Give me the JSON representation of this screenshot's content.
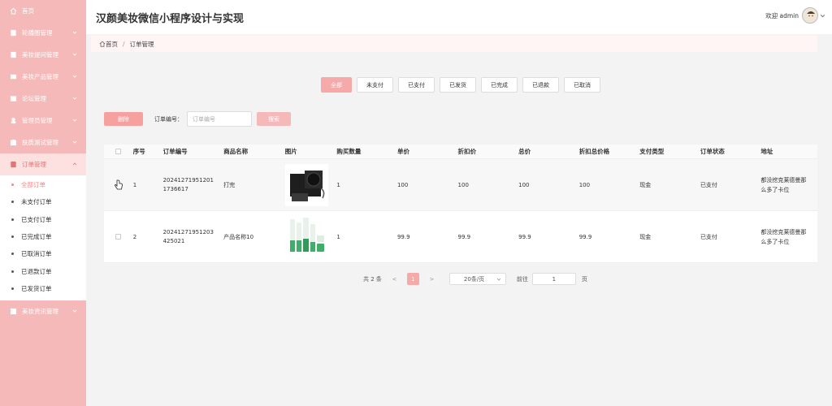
{
  "header": {
    "title": "汉颜美妆微信小程序设计与实现",
    "welcome": "欢迎 admin"
  },
  "sidebar": {
    "items": [
      {
        "label": "首页",
        "icon": "home-icon"
      },
      {
        "label": "轮播图管理",
        "icon": "shop-icon"
      },
      {
        "label": "美妆提问管理",
        "icon": "book-icon"
      },
      {
        "label": "美妆产品管理",
        "icon": "box-icon"
      },
      {
        "label": "论坛管理",
        "icon": "forum-icon"
      },
      {
        "label": "管理员管理",
        "icon": "admin-icon"
      },
      {
        "label": "肤质测试管理",
        "icon": "skin-test-icon"
      },
      {
        "label": "订单管理",
        "icon": "order-icon"
      }
    ],
    "sub_items": [
      "全部订单",
      "未支付订单",
      "已支付订单",
      "已完成订单",
      "已取消订单",
      "已退款订单",
      "已发货订单"
    ],
    "last_item": {
      "label": "美妆资讯管理",
      "icon": "news-icon"
    }
  },
  "breadcrumb": {
    "home": "首页",
    "current": "订单管理"
  },
  "tabs": [
    "全部",
    "未支付",
    "已支付",
    "已发货",
    "已完成",
    "已退款",
    "已取消"
  ],
  "toolbar": {
    "delete_label": "删除",
    "order_label": "订单编号：",
    "order_placeholder": "订单编号",
    "search_label": "搜索"
  },
  "table": {
    "headers": [
      "序号",
      "订单编号",
      "商品名称",
      "图片",
      "购买数量",
      "单价",
      "折扣价",
      "总价",
      "折扣总价格",
      "支付类型",
      "订单状态",
      "地址"
    ],
    "rows": [
      {
        "no": "1",
        "order_line1": "20241271951201",
        "order_line2": "1736617",
        "name": "打完",
        "image": "power-supply-product-image",
        "qty": "1",
        "price": "100",
        "discount": "100",
        "total": "100",
        "discount_total": "100",
        "pay": "现金",
        "status": "已支付",
        "addr_line1": "都没挖克莱德曼那",
        "addr_line2": "么多了卡位"
      },
      {
        "no": "2",
        "order_line1": "20241271951203",
        "order_line2": "425021",
        "name": "产品名称10",
        "image": "cosmetics-product-image",
        "qty": "1",
        "price": "99.9",
        "discount": "99.9",
        "total": "99.9",
        "discount_total": "99.9",
        "pay": "现金",
        "status": "已支付",
        "addr_line1": "都没挖克莱德曼那",
        "addr_line2": "么多了卡位"
      }
    ]
  },
  "pager": {
    "total": "共 2 条",
    "prev": "<",
    "page": "1",
    "next": ">",
    "size": "20条/页",
    "goto_label": "前往",
    "goto_value": "1",
    "page_unit": "页"
  },
  "colors": {
    "sidebar_bg": "#f6b9b9",
    "accent": "#f6a9a9",
    "active_text": "#f08a8a"
  }
}
